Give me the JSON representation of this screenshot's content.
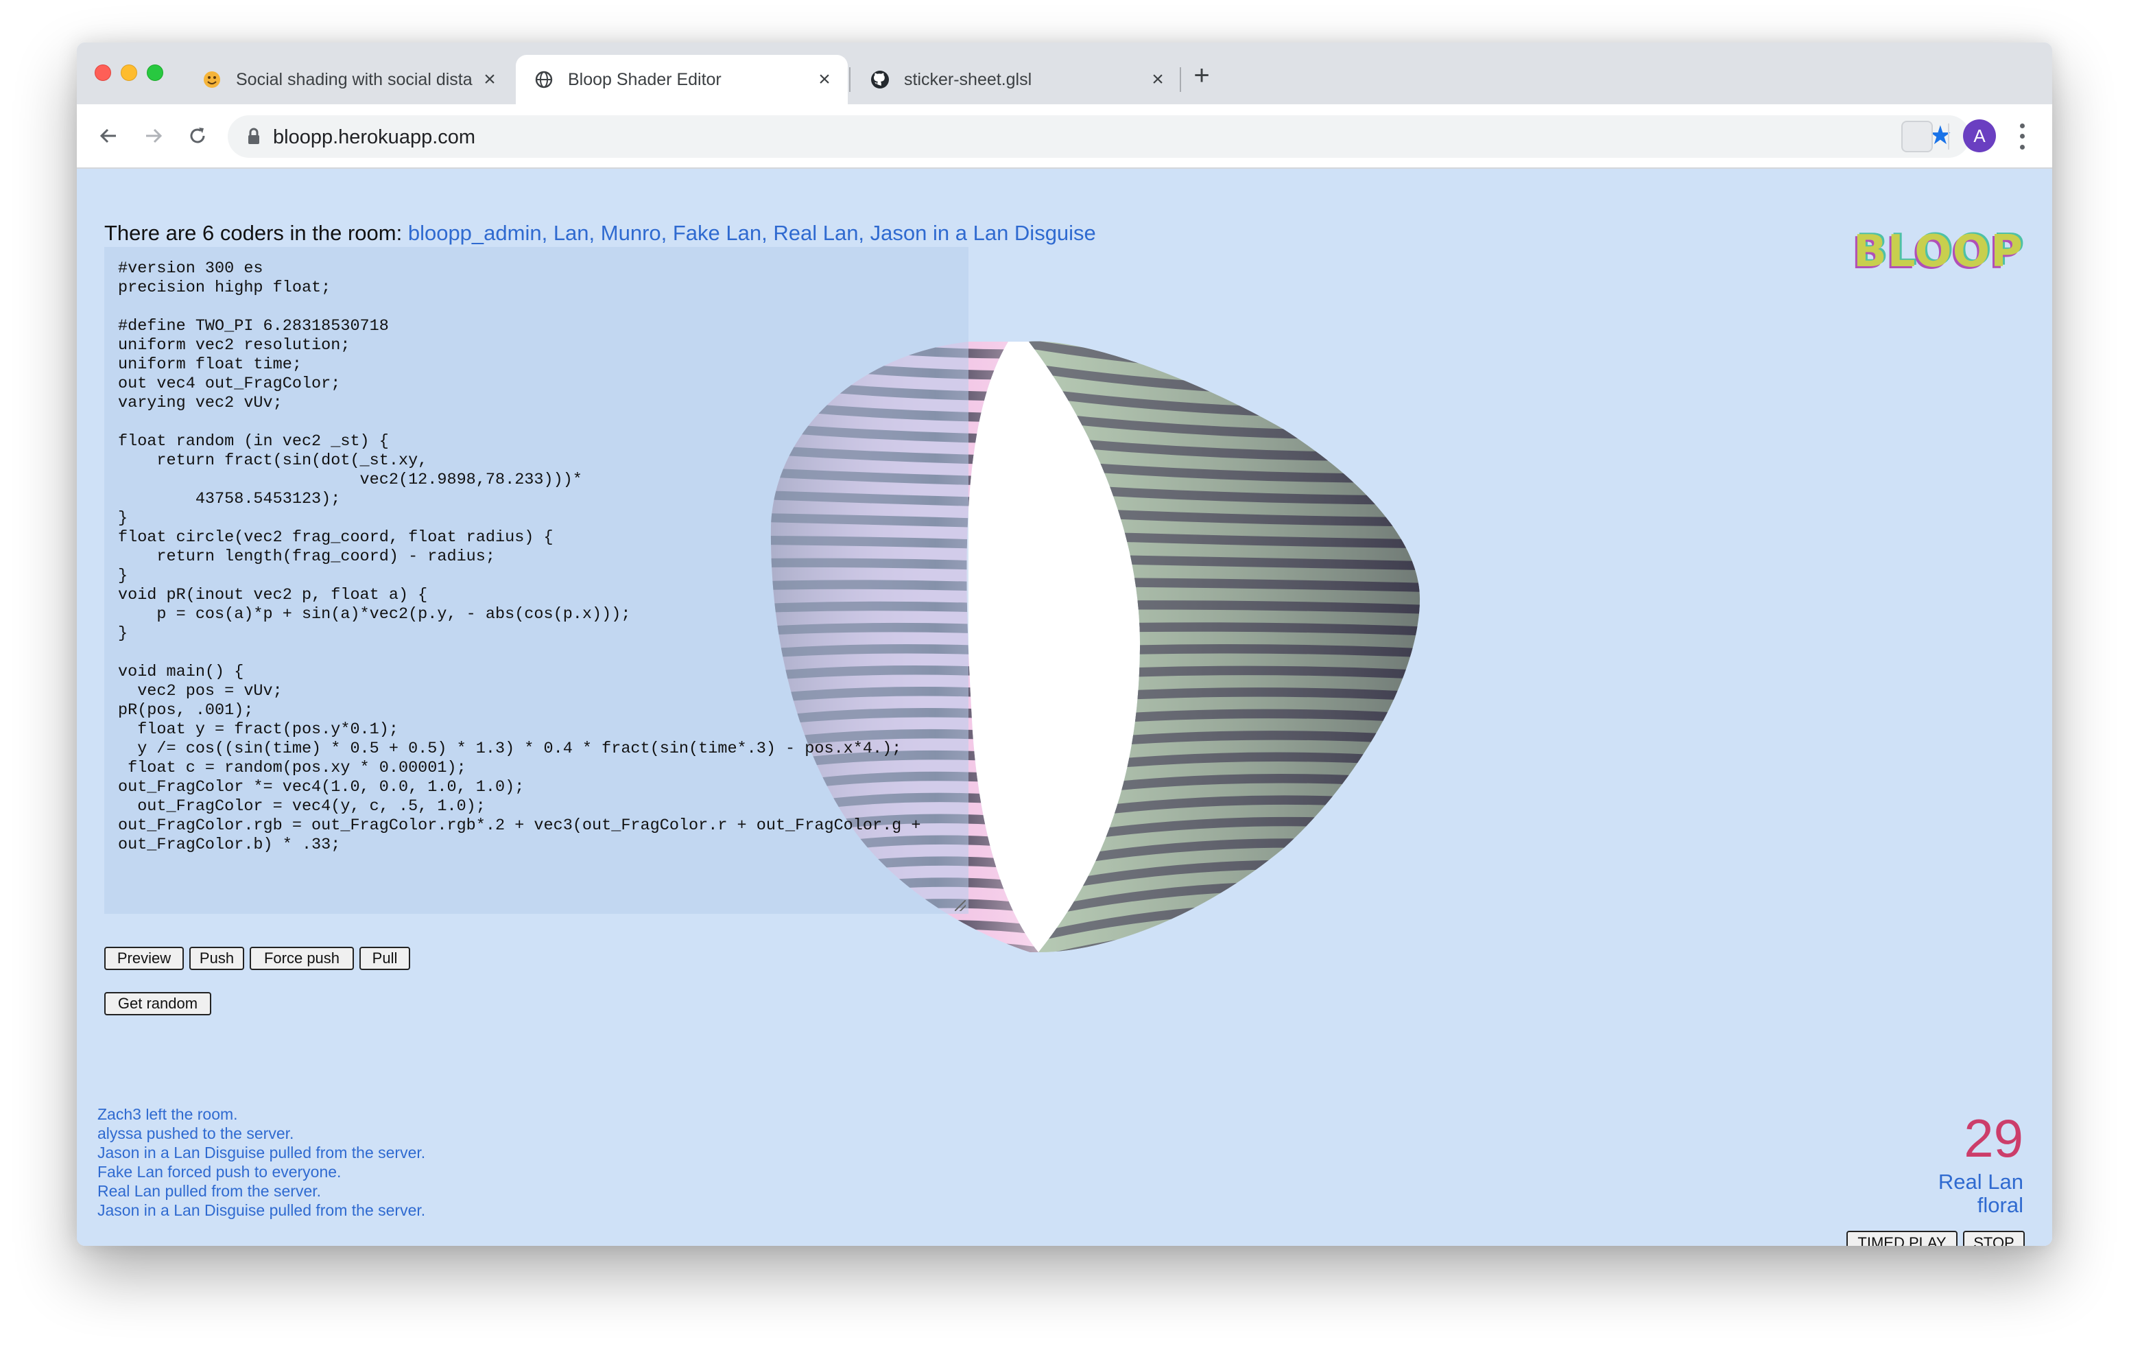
{
  "browser": {
    "tabs": [
      {
        "title": "Social shading with social dista",
        "favicon": "emoji-face-icon",
        "active": false
      },
      {
        "title": "Bloop Shader Editor",
        "favicon": "globe-icon",
        "active": true
      },
      {
        "title": "sticker-sheet.glsl",
        "favicon": "github-icon",
        "active": false
      }
    ],
    "url": "bloopp.herokuapp.com",
    "avatar_letter": "A"
  },
  "page": {
    "room_prefix": "There are 6 coders in the room: ",
    "room_members": "bloopp_admin, Lan, Munro, Fake Lan, Real Lan, Jason in a Lan Disguise",
    "logo": "BLOOP",
    "code": "#version 300 es\nprecision highp float;\n\n#define TWO_PI 6.28318530718\nuniform vec2 resolution;\nuniform float time;\nout vec4 out_FragColor;\nvarying vec2 vUv;\n\nfloat random (in vec2 _st) {\n    return fract(sin(dot(_st.xy,\n                         vec2(12.9898,78.233)))*\n        43758.5453123);\n}\nfloat circle(vec2 frag_coord, float radius) {\n    return length(frag_coord) - radius;\n}\nvoid pR(inout vec2 p, float a) {\n    p = cos(a)*p + sin(a)*vec2(p.y, - abs(cos(p.x)));\n}\n\nvoid main() {\n  vec2 pos = vUv;\npR(pos, .001);\n  float y = fract(pos.y*0.1);\n  y /= cos((sin(time) * 0.5 + 0.5) * 1.3) * 0.4 * fract(sin(time*.3) - pos.x*4.);\n float c = random(pos.xy * 0.00001);\nout_FragColor *= vec4(1.0, 0.0, 1.0, 1.0);\n  out_FragColor = vec4(y, c, .5, 1.0);\nout_FragColor.rgb = out_FragColor.rgb*.2 + vec3(out_FragColor.r + out_FragColor.g +\nout_FragColor.b) * .33;",
    "buttons": {
      "preview": "Preview",
      "push": "Push",
      "force_push": "Force push",
      "pull": "Pull",
      "get_random": "Get random",
      "timed_play": "TIMED PLAY",
      "stop": "STOP"
    },
    "activity_log": [
      "Zach3 left the room.",
      "alyssa pushed to the server.",
      "Jason in a Lan Disguise pulled from the server.",
      "Fake Lan forced push to everyone.",
      "Real Lan pulled from the server.",
      "Jason in a Lan Disguise pulled from the server."
    ],
    "reactions": [
      "👏",
      "😀"
    ],
    "timer": "29",
    "player_name": "Real Lan",
    "round_word": "floral"
  },
  "colors": {
    "page_background": "#cfe1f7",
    "link": "#2f6ad0",
    "timer": "#cc3d6a",
    "stripe_light": "#aabfa8",
    "stripe_dark": "#484659",
    "stripe_highlight": "#f2c7e6"
  }
}
